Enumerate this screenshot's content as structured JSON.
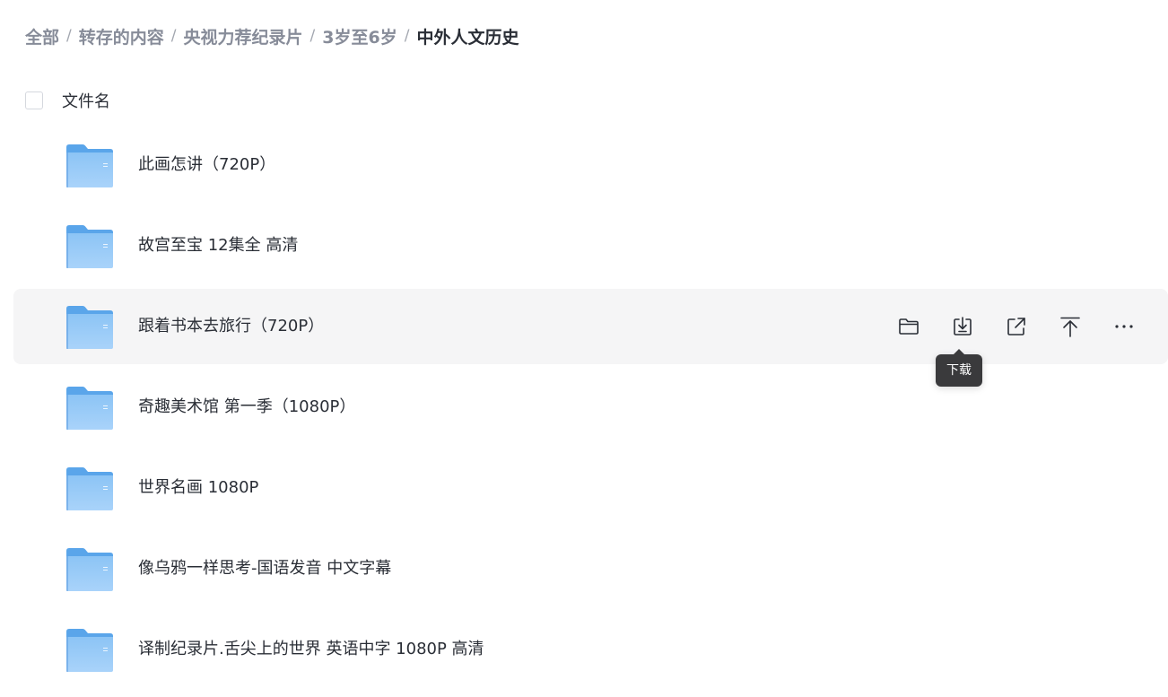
{
  "breadcrumb": {
    "items": [
      {
        "label": "全部"
      },
      {
        "label": "转存的内容"
      },
      {
        "label": "央视力荐纪录片"
      },
      {
        "label": "3岁至6岁"
      },
      {
        "label": "中外人文历史"
      }
    ],
    "separator": "/"
  },
  "list_header": {
    "column_name": "文件名"
  },
  "files": [
    {
      "name": "此画怎讲（720P）",
      "type": "folder"
    },
    {
      "name": "故宫至宝 12集全 高清",
      "type": "folder"
    },
    {
      "name": "跟着书本去旅行（720P）",
      "type": "folder"
    },
    {
      "name": "奇趣美术馆 第一季（1080P）",
      "type": "folder"
    },
    {
      "name": "世界名画 1080P",
      "type": "folder"
    },
    {
      "name": "像乌鸦一样思考-国语发音 中文字幕",
      "type": "folder"
    },
    {
      "name": "译制纪录片.舌尖上的世界 英语中字 1080P 高清",
      "type": "folder"
    }
  ],
  "row_actions": {
    "icons": [
      "folder-open-icon",
      "download-icon",
      "share-icon",
      "pin-to-top-icon",
      "more-icon"
    ]
  },
  "tooltip": {
    "text": "下载"
  },
  "colors": {
    "hover_row_bg": "#f5f5f6",
    "folder_blue": "#6fb2f0",
    "tooltip_bg": "#3a3a3c",
    "breadcrumb_inactive": "#878c99",
    "breadcrumb_active": "#2a2e36"
  }
}
